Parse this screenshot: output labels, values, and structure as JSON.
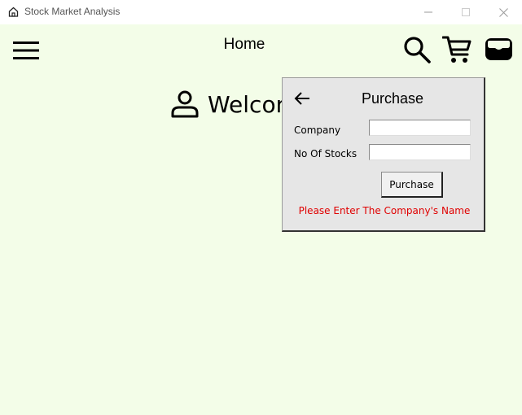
{
  "window": {
    "title": "Stock Market Analysis",
    "controls": [
      "minimize",
      "maximize",
      "close"
    ]
  },
  "header": {
    "title": "Home",
    "icons": [
      "hamburger-menu-icon",
      "search-icon",
      "cart-icon",
      "wallet-icon"
    ]
  },
  "welcome": {
    "text": "Welcome",
    "icon": "user-icon"
  },
  "purchase_dialog": {
    "title": "Purchase",
    "company_label": "Company",
    "company_value": "",
    "stocks_label": "No Of Stocks",
    "stocks_value": "",
    "button_label": "Purchase",
    "error_message": "Please Enter The Company's Name"
  },
  "colors": {
    "background": "#f3fde8",
    "dialog_background": "#e6e6e6",
    "error": "#e00000"
  }
}
